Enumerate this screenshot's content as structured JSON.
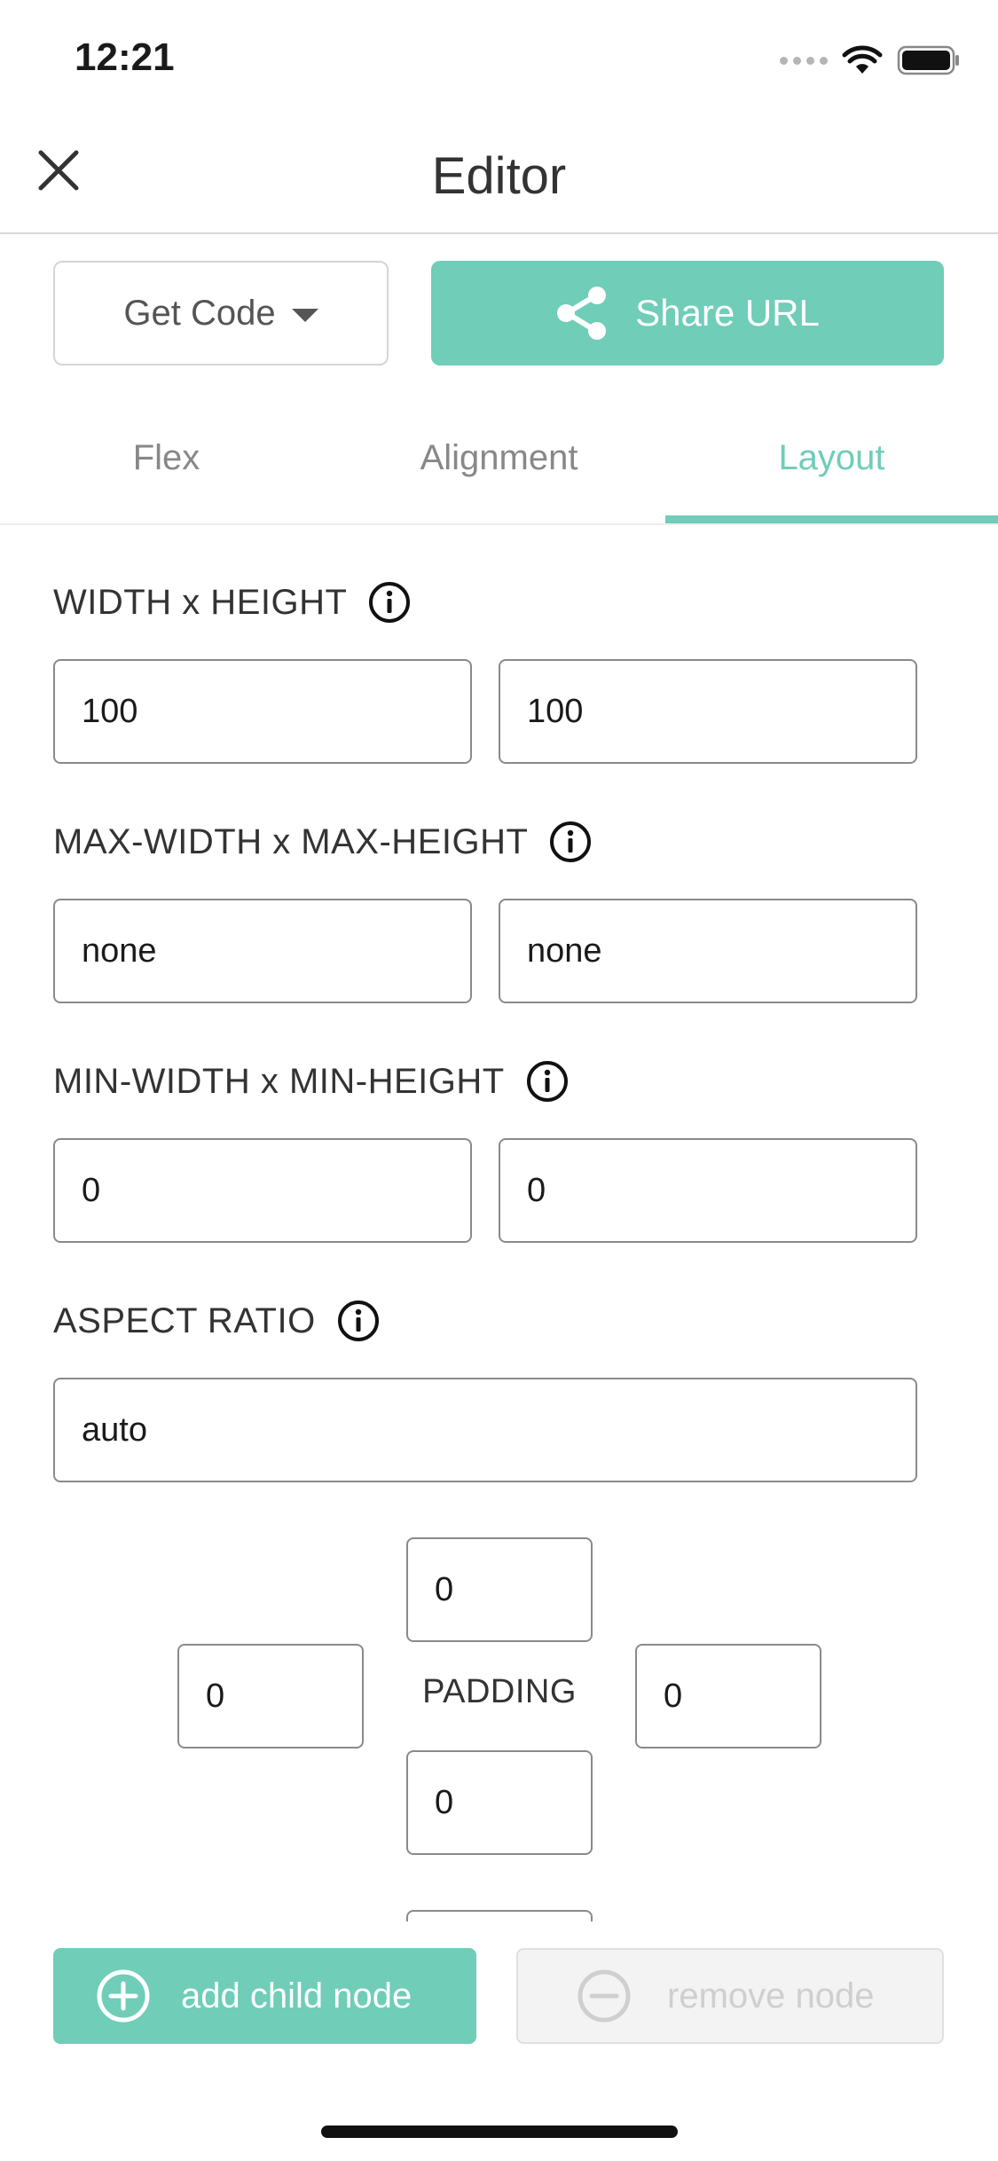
{
  "status_bar": {
    "time": "12:21"
  },
  "nav": {
    "title": "Editor"
  },
  "toolbar": {
    "get_code_label": "Get Code",
    "share_label": "Share URL"
  },
  "tabs": [
    {
      "label": "Flex",
      "active": false
    },
    {
      "label": "Alignment",
      "active": false
    },
    {
      "label": "Layout",
      "active": true
    }
  ],
  "sections": {
    "size": {
      "label": "WIDTH x HEIGHT",
      "width": "100",
      "height": "100"
    },
    "max_size": {
      "label": "MAX-WIDTH x MAX-HEIGHT",
      "width": "none",
      "height": "none"
    },
    "min_size": {
      "label": "MIN-WIDTH x MIN-HEIGHT",
      "width": "0",
      "height": "0"
    },
    "aspect_ratio": {
      "label": "ASPECT RATIO",
      "value": "auto"
    },
    "padding": {
      "label": "PADDING",
      "top": "0",
      "left": "0",
      "right": "0",
      "bottom": "0"
    }
  },
  "actions": {
    "add_label": "add child node",
    "remove_label": "remove node"
  },
  "colors": {
    "accent": "#6fcdb8",
    "text": "#333333",
    "muted": "#888888",
    "disabled": "#cfcfcf"
  },
  "icons": [
    "close-icon",
    "chevron-down-icon",
    "share-icon",
    "info-icon",
    "plus-circle-icon",
    "minus-circle-icon",
    "wifi-icon",
    "battery-icon"
  ]
}
